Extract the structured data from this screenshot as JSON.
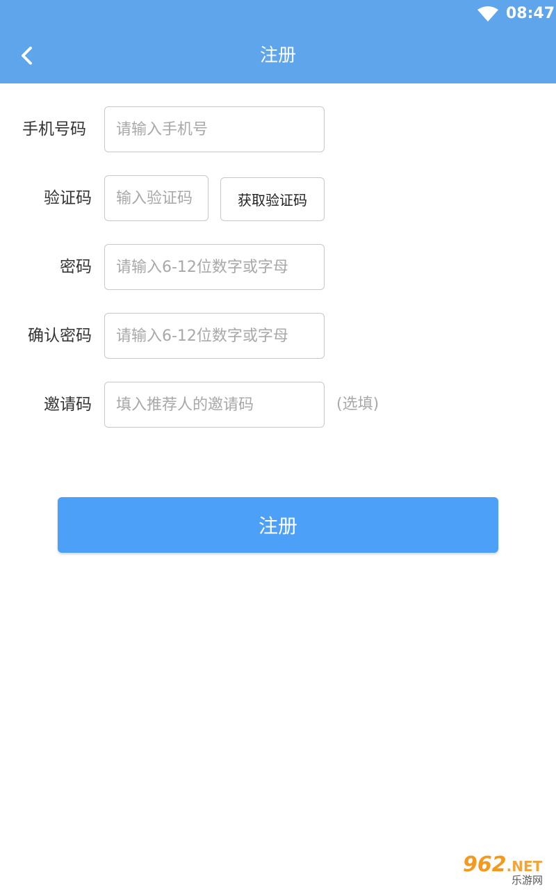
{
  "status_bar": {
    "time": "08:47",
    "wifi_icon": "wifi-icon"
  },
  "header": {
    "back_icon": "chevron-left-icon",
    "title": "注册"
  },
  "form": {
    "phone": {
      "label": "手机号码",
      "placeholder": "请输入手机号",
      "value": ""
    },
    "verification_code": {
      "label": "验证码",
      "placeholder": "输入验证码",
      "value": "",
      "button_label": "获取验证码"
    },
    "password": {
      "label": "密码",
      "placeholder": "请输入6-12位数字或字母",
      "value": ""
    },
    "confirm_password": {
      "label": "确认密码",
      "placeholder": "请输入6-12位数字或字母",
      "value": ""
    },
    "invite_code": {
      "label": "邀请码",
      "placeholder": "填入推荐人的邀请码",
      "value": "",
      "hint": "(选填)"
    }
  },
  "submit": {
    "label": "注册"
  },
  "watermark": {
    "brand": "962",
    "suffix": ".NET",
    "subtitle": "乐游网"
  },
  "colors": {
    "header_bg": "#5ea5ec",
    "button_bg": "#4da0f7",
    "placeholder": "#a8a8a8",
    "border": "#c8c8c8"
  }
}
